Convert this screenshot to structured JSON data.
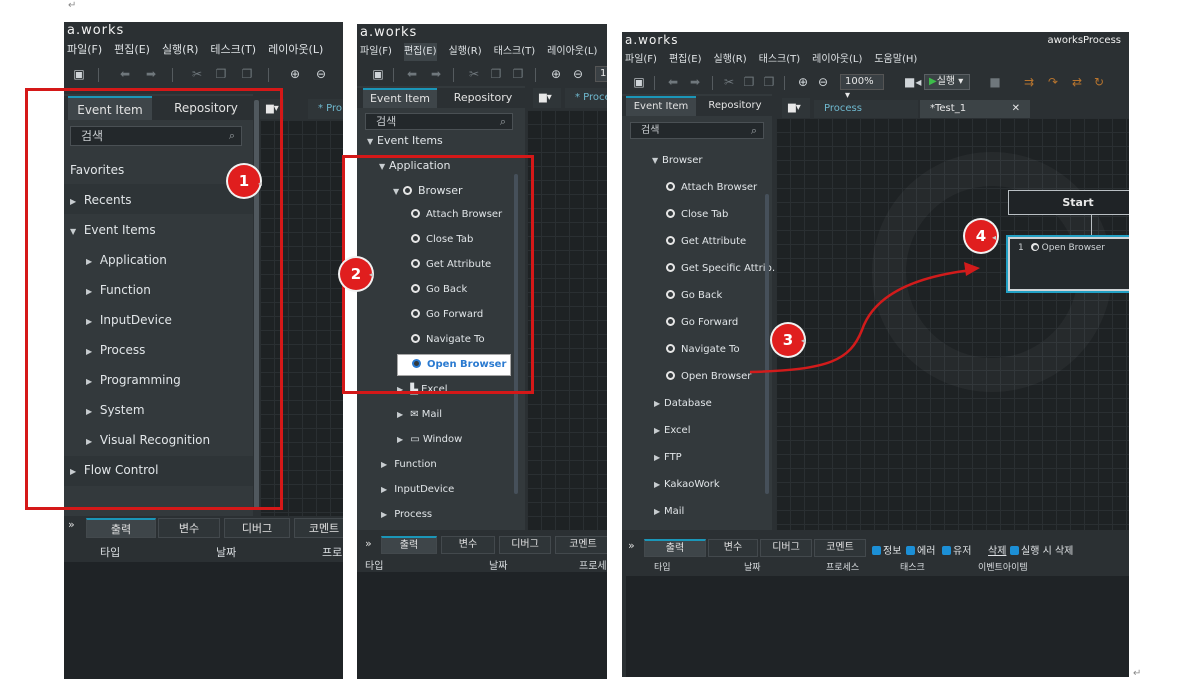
{
  "marks": {
    "para": "↵"
  },
  "panel1": {
    "app_title": "a.works",
    "menu": [
      "파일(F)",
      "편집(E)",
      "실행(R)",
      "테스크(T)",
      "레이아웃(L)"
    ],
    "tabs": {
      "event_item": "Event Item",
      "repository": "Repository"
    },
    "search_placeholder": "검색",
    "tree": [
      "Favorites",
      "Recents",
      "Event Items",
      "Application",
      "Function",
      "InputDevice",
      "Process",
      "Programming",
      "System",
      "Visual Recognition",
      "Flow Control"
    ],
    "doc_tab": "* Pro",
    "bottom_tabs": [
      "출력",
      "변수",
      "디버그",
      "코멘트"
    ],
    "columns": [
      "타입",
      "날짜",
      "프로"
    ],
    "badge": "1"
  },
  "panel2": {
    "app_title": "a.works",
    "menu": [
      "파일(F)",
      "편집(E)",
      "실행(R)",
      "태스크(T)",
      "레이아웃(L)"
    ],
    "tabs": {
      "event_item": "Event Item",
      "repository": "Repository"
    },
    "search_placeholder": "검색",
    "zoom": "1",
    "doc_tab": "* Proce",
    "tree": [
      "Event Items",
      "Application",
      "Browser",
      "Attach Browser",
      "Close Tab",
      "Get Attribute",
      "Go Back",
      "Go Forward",
      "Navigate To",
      "Open Browser",
      "Excel",
      "Mail",
      "Window",
      "Function",
      "InputDevice",
      "Process"
    ],
    "bottom_tabs": [
      "출력",
      "변수",
      "디버그",
      "코멘트"
    ],
    "columns": [
      "타입",
      "날짜",
      "프로세스"
    ],
    "badge": "2"
  },
  "panel3": {
    "app_title": "a.works",
    "window_title": "aworksProcess",
    "menu": [
      "파일(F)",
      "편집(E)",
      "실행(R)",
      "태스크(T)",
      "레이아웃(L)",
      "도움말(H)"
    ],
    "zoom": "100%",
    "run_label": "실행",
    "tabs": {
      "event_item": "Event Item",
      "repository": "Repository"
    },
    "search_placeholder": "검색",
    "tree": [
      "Browser",
      "Attach Browser",
      "Close Tab",
      "Get Attribute",
      "Get Specific Attrib…",
      "Go Back",
      "Go Forward",
      "Navigate To",
      "Open Browser",
      "Database",
      "Excel",
      "FTP",
      "KakaoWork",
      "Mail"
    ],
    "doc_tabs": {
      "process": "Process",
      "test": "*Test_1",
      "close": "✕"
    },
    "start_node": "Start",
    "open_node": {
      "index": "1",
      "label": "Open Browser"
    },
    "bottom_tabs": [
      "출력",
      "변수",
      "디버그",
      "코멘트"
    ],
    "filters": [
      "정보",
      "에러",
      "유저"
    ],
    "delete_label": "삭제",
    "delete_on_run": "실행 시 삭제",
    "columns": [
      "타입",
      "날짜",
      "프로세스",
      "태스크",
      "이벤트아이템"
    ],
    "badge3": "3",
    "badge4": "4"
  },
  "colors": {
    "accent": "#1b96b8",
    "badge": "#e01e1e",
    "redbox": "#d51818"
  }
}
